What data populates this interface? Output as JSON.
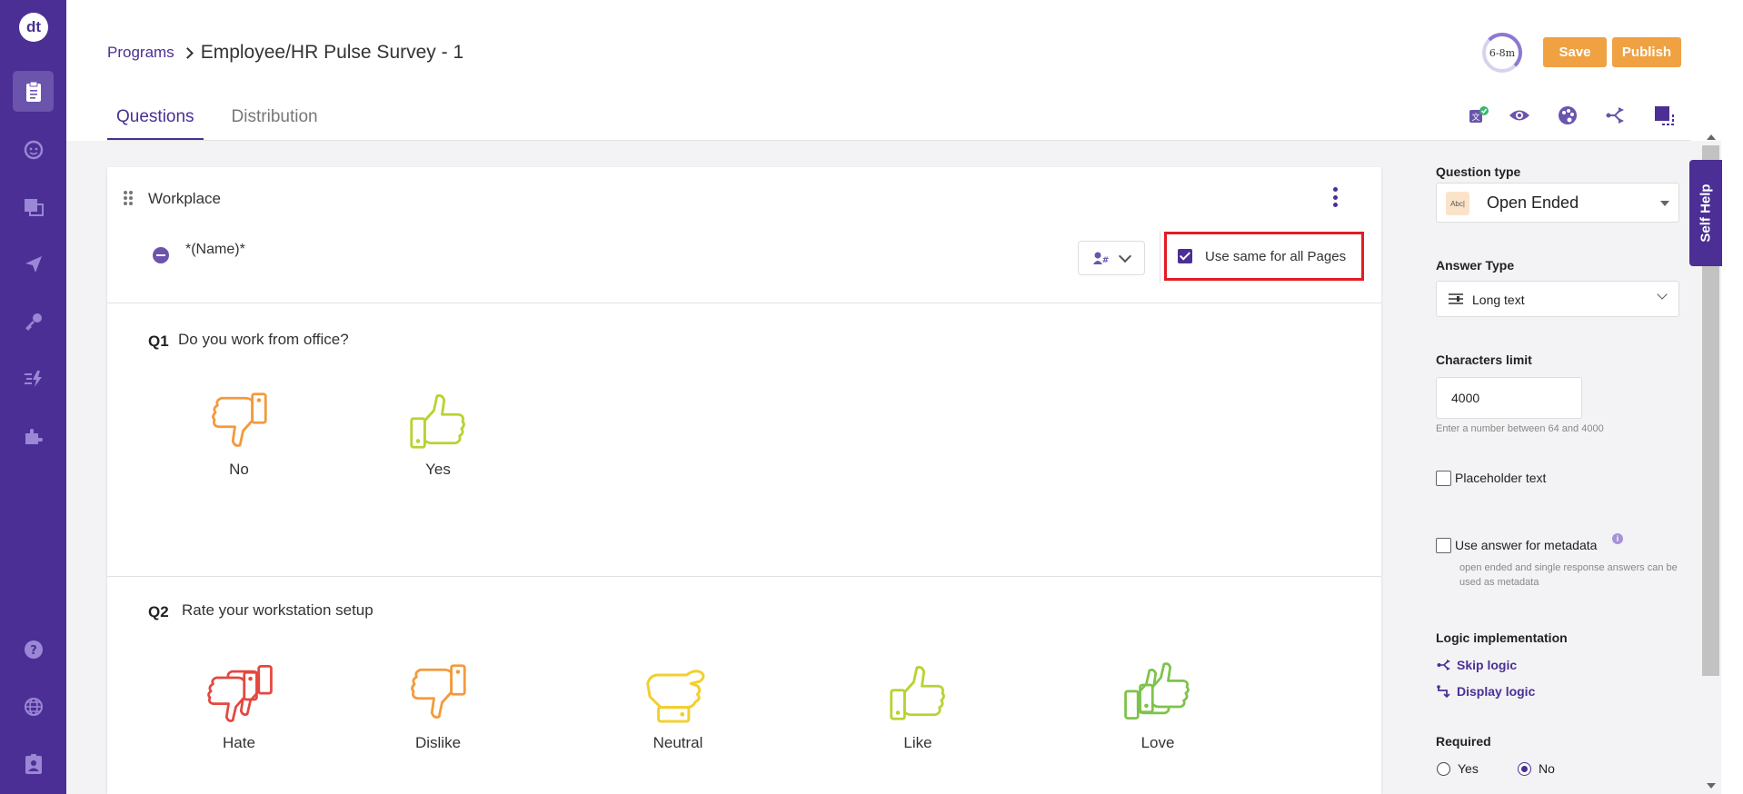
{
  "app": {
    "logo_text": "dt"
  },
  "leftnav": {
    "items": [
      {
        "icon": "clipboard-icon",
        "active": true
      },
      {
        "icon": "persona-icon"
      },
      {
        "icon": "pages-icon"
      },
      {
        "icon": "paper-plane-icon"
      },
      {
        "icon": "key-icon"
      },
      {
        "icon": "lightning-icon"
      },
      {
        "icon": "puzzle-icon"
      }
    ],
    "bottom_items": [
      {
        "icon": "help-icon"
      },
      {
        "icon": "globe-icon"
      },
      {
        "icon": "id-badge-icon"
      }
    ]
  },
  "header": {
    "breadcrumb_link": "Programs",
    "title": "Employee/HR Pulse Survey - 1",
    "timer_label": "6-8m",
    "save_label": "Save",
    "publish_label": "Publish"
  },
  "tabs": [
    {
      "label": "Questions",
      "active": true
    },
    {
      "label": "Distribution",
      "active": false
    }
  ],
  "toolbar_icons": [
    "translate-check-icon",
    "eye-icon",
    "theme-palette-icon",
    "branch-logic-icon",
    "resize-icon"
  ],
  "page": {
    "name": "Workplace",
    "subtitle": "*(Name)*",
    "use_same_label": "Use same for all Pages",
    "use_same_checked": true
  },
  "questions": [
    {
      "number": "Q1",
      "text": "Do you work from office?",
      "choices": [
        {
          "label": "No",
          "icon": "thumbs-down-icon",
          "color": "#f39a3d"
        },
        {
          "label": "Yes",
          "icon": "thumbs-up-icon",
          "color": "#b9d231"
        }
      ]
    },
    {
      "number": "Q2",
      "text": "Rate your workstation setup",
      "choices": [
        {
          "label": "Hate",
          "icon": "double-thumbs-down-icon",
          "color": "#e4473f"
        },
        {
          "label": "Dislike",
          "icon": "thumbs-down-icon",
          "color": "#f39a3d"
        },
        {
          "label": "Neutral",
          "icon": "thumb-sideways-icon",
          "color": "#f2cf2d"
        },
        {
          "label": "Like",
          "icon": "thumbs-up-icon",
          "color": "#b9d231"
        },
        {
          "label": "Love",
          "icon": "double-thumbs-up-icon",
          "color": "#7dc34a"
        }
      ]
    }
  ],
  "right_panel": {
    "question_type_label": "Question type",
    "question_type_value": "Open Ended",
    "question_type_icon_text": "Abc|",
    "answer_type_label": "Answer Type",
    "answer_type_value": "Long text",
    "char_limit_label": "Characters limit",
    "char_limit_value": "4000",
    "char_limit_hint": "Enter a number between 64 and 4000",
    "placeholder_label": "Placeholder text",
    "metadata_label": "Use answer for metadata",
    "metadata_info": "i",
    "metadata_hint": "open ended and single response answers can be used as metadata",
    "logic_label": "Logic implementation",
    "skip_logic": "Skip logic",
    "display_logic": "Display logic",
    "required_label": "Required",
    "required_yes": "Yes",
    "required_no": "No",
    "required_value": "No"
  },
  "self_help_label": "Self Help",
  "colors": {
    "brand": "#4b2f95",
    "accent": "#f0a142",
    "highlight": "#e31c23"
  }
}
